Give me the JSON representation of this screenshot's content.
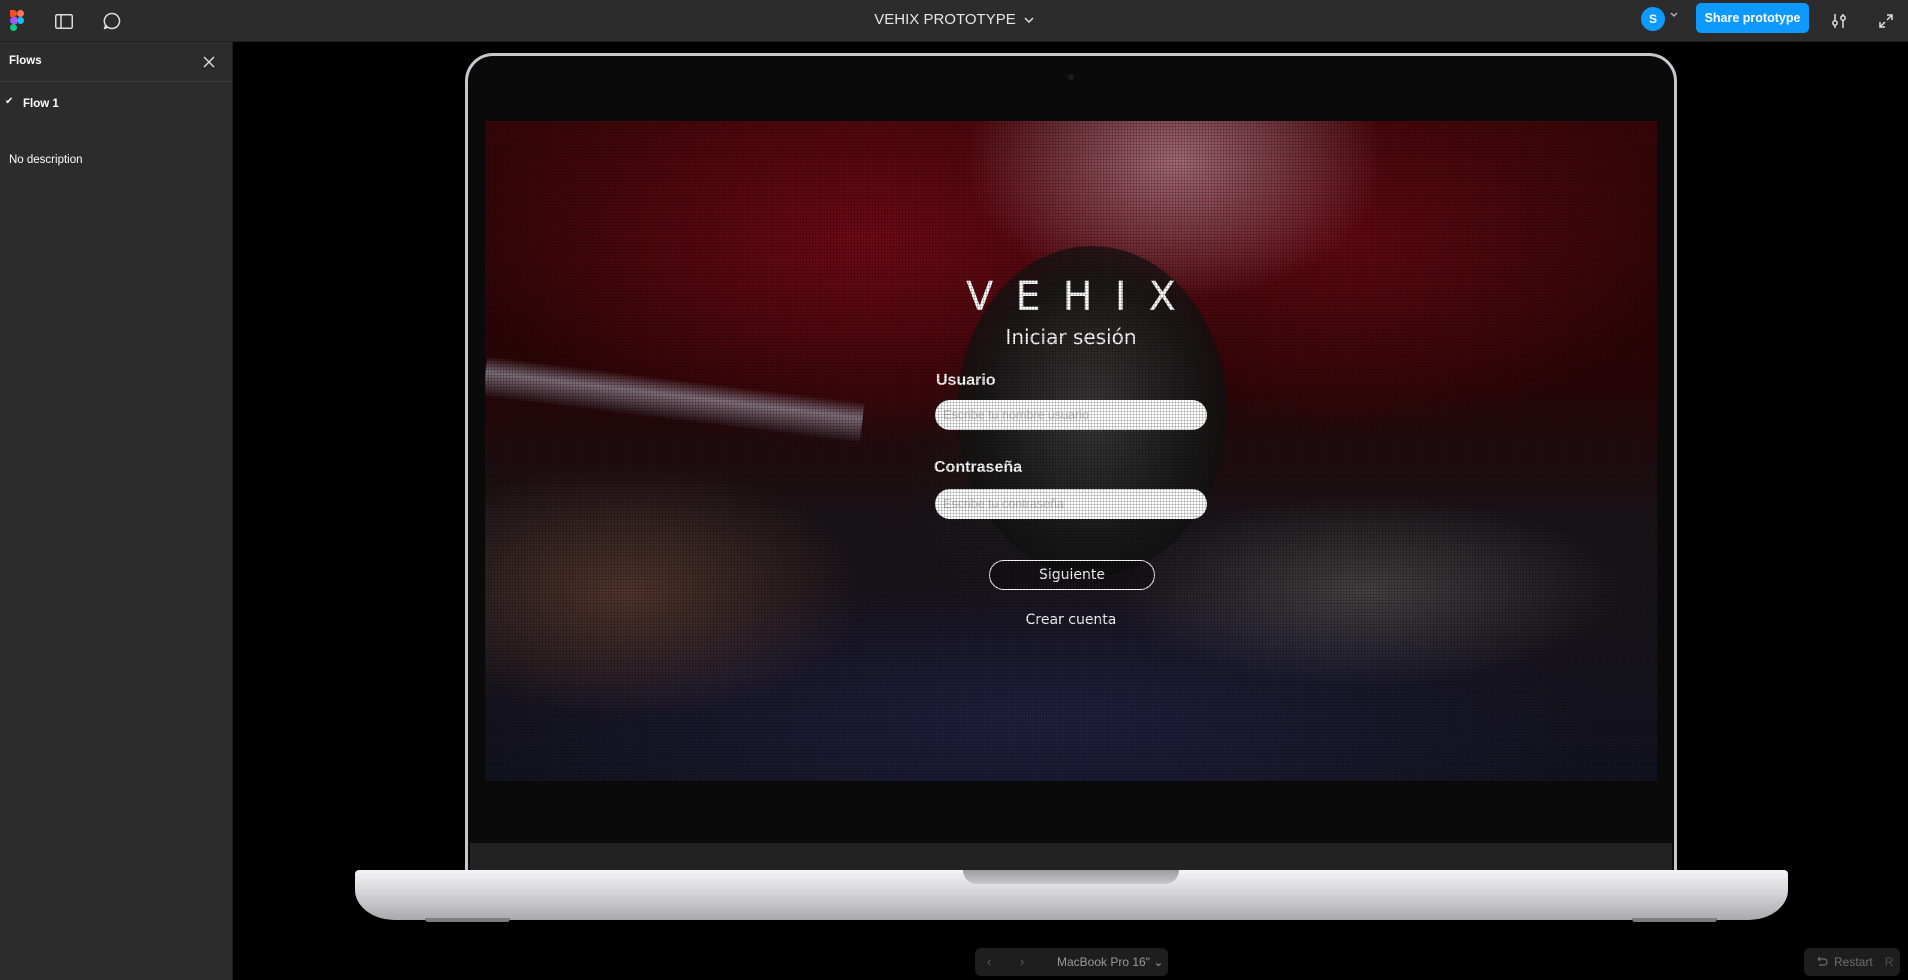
{
  "topbar": {
    "title": "VEHIX PROTOTYPE",
    "avatar_initial": "S",
    "share_label": "Share prototype",
    "icons": [
      "figma-logo-icon",
      "sidebar-toggle-icon",
      "comment-icon",
      "chevron-down-icon",
      "settings-sliders-icon",
      "expand-icon"
    ]
  },
  "sidebar": {
    "title": "Flows",
    "flows": [
      {
        "label": "Flow 1",
        "selected": true
      }
    ],
    "description": "No description"
  },
  "screen": {
    "brand": "VEHIX",
    "subtitle": "Iniciar sesión",
    "username_label": "Usuario",
    "username_placeholder": "Escribe tu nombre usuario",
    "password_label": "Contraseña",
    "password_placeholder": "Escribe tu contraseña",
    "next_button": "Siguiente",
    "create_account": "Crear cuenta"
  },
  "bottom": {
    "device": "MacBook Pro 16\"",
    "restart_label": "Restart",
    "restart_key": "R"
  },
  "colors": {
    "accent": "#0d99ff",
    "chrome": "#2c2c2c",
    "canvas": "#000000"
  }
}
